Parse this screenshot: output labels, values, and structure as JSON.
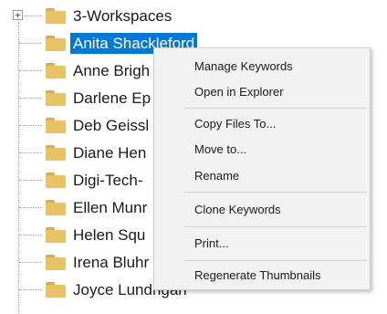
{
  "tree": {
    "items": [
      {
        "label": "3-Workspaces",
        "expander": "+"
      },
      {
        "label": "Anita Shackleford"
      },
      {
        "label": "Anne Brigh"
      },
      {
        "label": "Darlene Ep"
      },
      {
        "label": "Deb Geissl"
      },
      {
        "label": "Diane Hen"
      },
      {
        "label": "Digi-Tech-"
      },
      {
        "label": "Ellen Munr"
      },
      {
        "label": "Helen Squ"
      },
      {
        "label": "Irena Bluhr"
      },
      {
        "label": "Joyce Lundrigan"
      }
    ],
    "selected_index": 1
  },
  "context_menu": {
    "items": [
      {
        "label": "Manage Keywords"
      },
      {
        "label": "Open in Explorer"
      },
      {
        "label": "Copy Files To..."
      },
      {
        "label": "Move to..."
      },
      {
        "label": "Rename"
      },
      {
        "label": "Clone Keywords"
      },
      {
        "label": "Print..."
      },
      {
        "label": "Regenerate Thumbnails"
      }
    ]
  },
  "colors": {
    "selection": "#0078d7",
    "folder": "#e9c363",
    "menu_background": "#f2f2f2"
  }
}
